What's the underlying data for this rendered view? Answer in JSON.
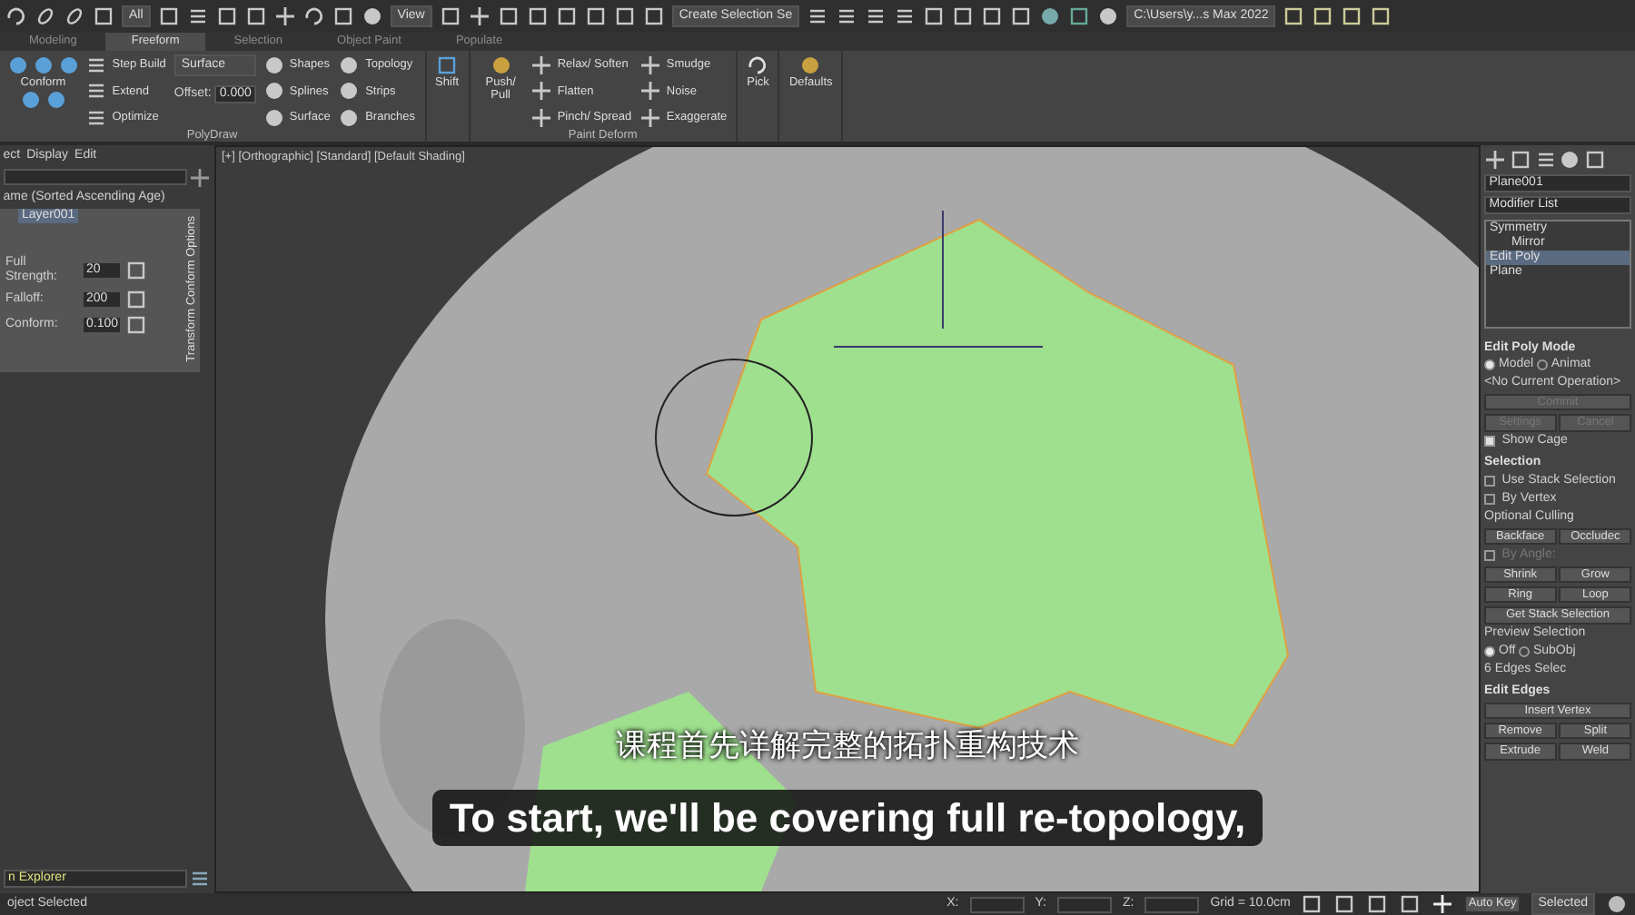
{
  "toolbar": {
    "selection_filter": "All",
    "reference_coord": "View",
    "named_selection": "Create Selection Se",
    "project_path": "C:\\Users\\y...s Max 2022"
  },
  "ribbon_tabs": [
    {
      "label": "Modeling",
      "selected": false
    },
    {
      "label": "Freeform",
      "selected": true
    },
    {
      "label": "Selection",
      "selected": false
    },
    {
      "label": "Object Paint",
      "selected": false
    },
    {
      "label": "Populate",
      "selected": false
    }
  ],
  "polydraw": {
    "title": "PolyDraw",
    "conform": "Conform",
    "tools": [
      "Step Build",
      "Extend",
      "Optimize"
    ],
    "surface_dropdown": "Surface",
    "offset_label": "Offset:",
    "offset_value": "0.000",
    "shapes": [
      "Shapes",
      "Splines",
      "Surface"
    ],
    "topology": [
      "Topology",
      "Strips",
      "Branches"
    ]
  },
  "shift": {
    "label": "Shift"
  },
  "paint_deform": {
    "title": "Paint Deform",
    "push_pull": "Push/ Pull",
    "col_1": [
      "Relax/ Soften",
      "Flatten",
      "Pinch/ Spread"
    ],
    "col_2": [
      "Smudge",
      "Noise",
      "Exaggerate"
    ]
  },
  "pick": {
    "label": "Pick"
  },
  "defaults": {
    "label": "Defaults"
  },
  "scene_explorer": {
    "menu": [
      "ect",
      "Display",
      "Edit"
    ],
    "sort_label": "ame (Sorted Ascending Age)",
    "layer": "Layer001",
    "explorer_name": "n Explorer",
    "status": "oject Selected"
  },
  "conform_options": {
    "title": "Transform Conform Options",
    "fields": [
      {
        "label": "Full Strength:",
        "value": "20"
      },
      {
        "label": "Falloff:",
        "value": "200"
      },
      {
        "label": "Conform:",
        "value": "0.100"
      }
    ]
  },
  "viewport": {
    "label": "[+] [Orthographic] [Standard] [Default Shading]",
    "subtitle_zh": "课程首先详解完整的拓扑重构技术",
    "subtitle_en": "To start, we'll be covering full re-topology,"
  },
  "command_panel": {
    "object_name": "Plane001",
    "modifier_list": "Modifier List",
    "stack": [
      {
        "label": "Symmetry",
        "selected": false,
        "children": [
          {
            "label": "Mirror",
            "selected": false
          }
        ]
      },
      {
        "label": "Edit Poly",
        "selected": true
      },
      {
        "label": "Plane",
        "selected": false
      }
    ],
    "rollouts": [
      {
        "title": "Edit Poly Mode",
        "rows": [
          {
            "kind": "radio",
            "options": [
              {
                "label": "Model",
                "selected": true
              },
              {
                "label": "Animat",
                "selected": false
              }
            ]
          },
          {
            "kind": "text",
            "label": "<No Current Operation>"
          },
          {
            "kind": "buttons",
            "buttons": [
              {
                "label": "Commit",
                "disabled": true
              }
            ]
          },
          {
            "kind": "buttons",
            "buttons": [
              {
                "label": "Settings",
                "disabled": true
              },
              {
                "label": "Cancel",
                "disabled": true
              }
            ]
          },
          {
            "kind": "check",
            "label": "Show Cage",
            "checked": true,
            "disabled": false
          }
        ]
      },
      {
        "title": "Selection",
        "rows": [
          {
            "kind": "check",
            "label": "Use Stack Selection",
            "checked": false,
            "disabled": false
          },
          {
            "kind": "check",
            "label": "By Vertex",
            "checked": false,
            "disabled": false
          },
          {
            "kind": "text",
            "label": "Optional Culling"
          },
          {
            "kind": "buttons",
            "buttons": [
              {
                "label": "Backface",
                "disabled": false
              },
              {
                "label": "Occludec",
                "disabled": false
              }
            ]
          },
          {
            "kind": "check",
            "label": "By Angle:",
            "checked": false,
            "disabled": true
          },
          {
            "kind": "buttons",
            "buttons": [
              {
                "label": "Shrink",
                "disabled": false
              },
              {
                "label": "Grow",
                "disabled": false
              }
            ]
          },
          {
            "kind": "buttons",
            "buttons": [
              {
                "label": "Ring",
                "disabled": false
              },
              {
                "label": "Loop",
                "disabled": false
              }
            ]
          },
          {
            "kind": "buttons",
            "buttons": [
              {
                "label": "Get Stack Selection",
                "disabled": false
              }
            ]
          },
          {
            "kind": "text",
            "label": "Preview Selection"
          },
          {
            "kind": "radio",
            "options": [
              {
                "label": "Off",
                "selected": true
              },
              {
                "label": "SubObj",
                "selected": false
              }
            ]
          },
          {
            "kind": "text",
            "label": "6 Edges Selec"
          }
        ]
      },
      {
        "title": "Edit Edges",
        "rows": [
          {
            "kind": "buttons",
            "buttons": [
              {
                "label": "Insert Vertex",
                "disabled": false
              }
            ]
          },
          {
            "kind": "buttons",
            "buttons": [
              {
                "label": "Remove",
                "disabled": false
              },
              {
                "label": "Split",
                "disabled": false
              }
            ]
          },
          {
            "kind": "buttons",
            "buttons": [
              {
                "label": "Extrude",
                "disabled": false
              },
              {
                "label": "Weld",
                "disabled": false
              }
            ]
          }
        ]
      }
    ]
  },
  "status_bar": {
    "coords": [
      "X:",
      "Y:",
      "Z:"
    ],
    "grid": "Grid = 10.0cm",
    "auto_key": "Auto Key",
    "key_filter": "Selected"
  }
}
